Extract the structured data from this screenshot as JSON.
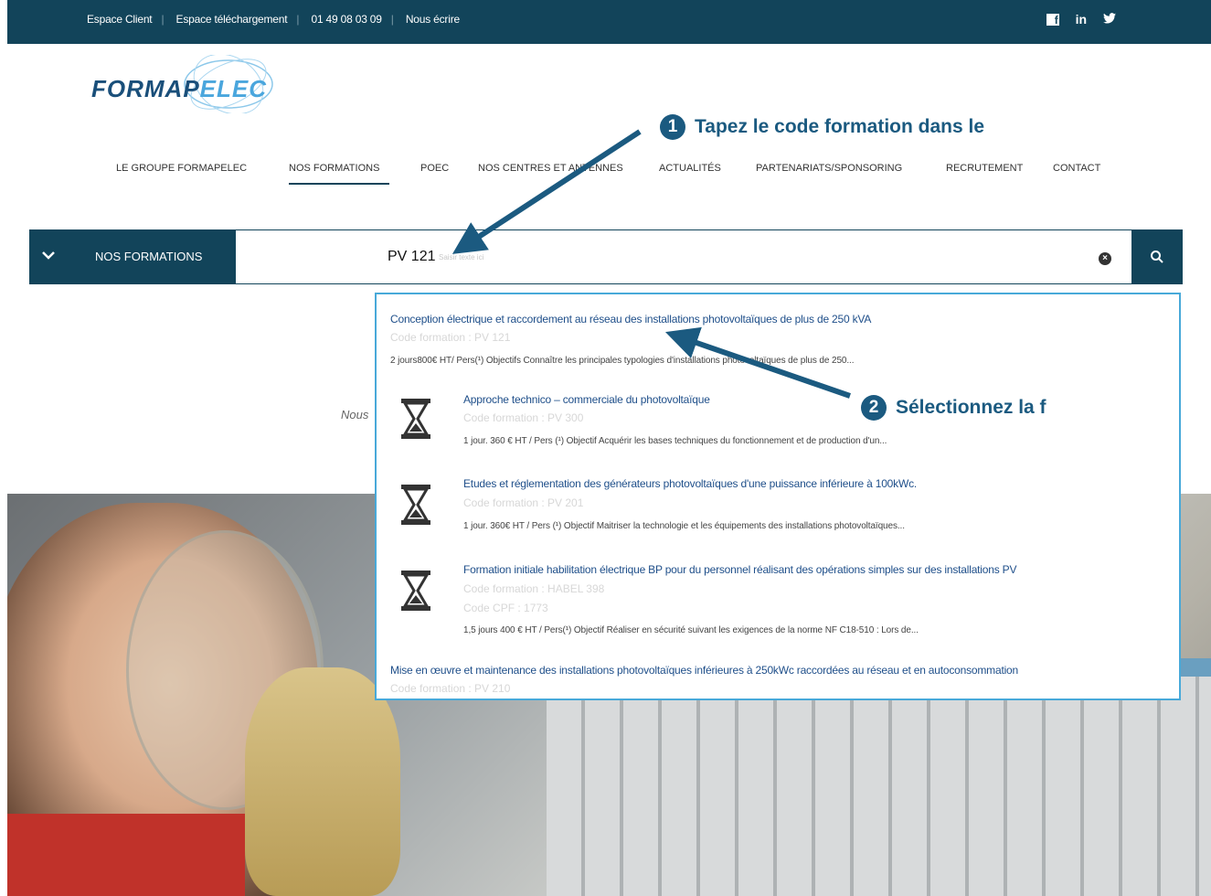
{
  "topbar": {
    "links": [
      "Espace Client",
      "Espace téléchargement",
      "01 49 08 03 09",
      "Nous écrire"
    ],
    "social": [
      "facebook-icon",
      "linkedin-icon",
      "twitter-icon"
    ],
    "linkedin_label": "in"
  },
  "logo": {
    "part1": "FORMAP",
    "part2": "ELEC"
  },
  "nav": {
    "items": [
      "LE GROUPE FORMAPELEC",
      "NOS FORMATIONS",
      "POEC",
      "NOS CENTRES ET ANTENNES",
      "ACTUALITÉS",
      "PARTENARIATS/SPONSORING",
      "RECRUTEMENT",
      "CONTACT"
    ],
    "active": "NOS FORMATIONS"
  },
  "search": {
    "category_label": "NOS FORMATIONS",
    "value": "PV 121",
    "hint": "Saisir texte ici"
  },
  "intro": {
    "text": "Nous"
  },
  "results": [
    {
      "title": "Conception électrique et raccordement au réseau des installations photovoltaïques de plus de 250 kVA",
      "code": "Code formation : PV 121",
      "desc": "2 jours800€ HT/ Pers(¹) Objectifs Connaître les principales typologies d'installations photovoltaïques de plus de 250..."
    },
    {
      "title": "Approche technico – commerciale du photovoltaïque",
      "code": "Code formation : PV 300",
      "desc": "1 jour. 360 € HT / Pers (¹) Objectif Acquérir les bases techniques du fonctionnement et de production d'un..."
    },
    {
      "title": "Etudes et réglementation des générateurs photovoltaïques d'une puissance inférieure à 100kWc.",
      "code": "Code formation : PV 201",
      "desc": "1 jour. 360€ HT / Pers (¹) Objectif Maitriser la technologie et les équipements des installations photovoltaïques..."
    },
    {
      "title": "Formation initiale habilitation électrique BP pour du personnel réalisant des opérations simples sur des installations PV",
      "code": "Code formation : HABEL 398",
      "cpf": "Code CPF : 1773",
      "desc": "1,5 jours 400 € HT / Pers(¹) Objectif Réaliser en sécurité suivant les exigences de la norme NF C18-510 : Lors de..."
    },
    {
      "title": "Mise en œuvre et maintenance des installations photovoltaïques inférieures à 250kWc raccordées au réseau et en autoconsommation",
      "code": "Code formation : PV 210"
    }
  ],
  "annotations": {
    "step1_num": "1",
    "step1_text": "Tapez le code formation dans le",
    "step2_num": "2",
    "step2_text": "Sélectionnez la f"
  },
  "colors": {
    "brand_dark": "#12445a",
    "link_blue": "#1f4f8a",
    "dropdown_border": "#48a9d9",
    "annotation": "#1b5a80"
  }
}
